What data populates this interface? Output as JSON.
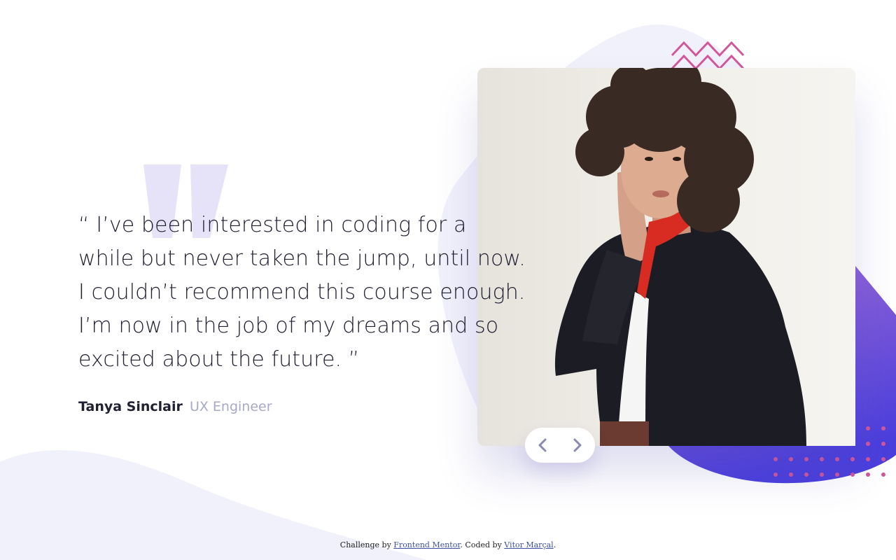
{
  "testimonial": {
    "quote": "“ I’ve been interested in coding for a while but never taken the jump, until now. I couldn’t recommend this course enough. I’m now in the job of my dreams and so excited about the future. ”",
    "author_name": "Tanya Sinclair",
    "author_role": "UX Engineer"
  },
  "slider": {
    "prev_icon": "chevron-left-icon",
    "next_icon": "chevron-right-icon"
  },
  "attribution": {
    "prefix": "Challenge by",
    "challenge_link": "Frontend Mentor",
    "middle": ". Coded by",
    "author_link": "Vitor Marçal",
    "suffix": "."
  },
  "colors": {
    "text_dark": "#202033",
    "role_gray": "#a8a8c8",
    "gradient_start": "#9e6ad6",
    "gradient_end": "#4b3fdc",
    "blob_light": "#f1f1fb",
    "pink_accent": "#d2569a"
  }
}
